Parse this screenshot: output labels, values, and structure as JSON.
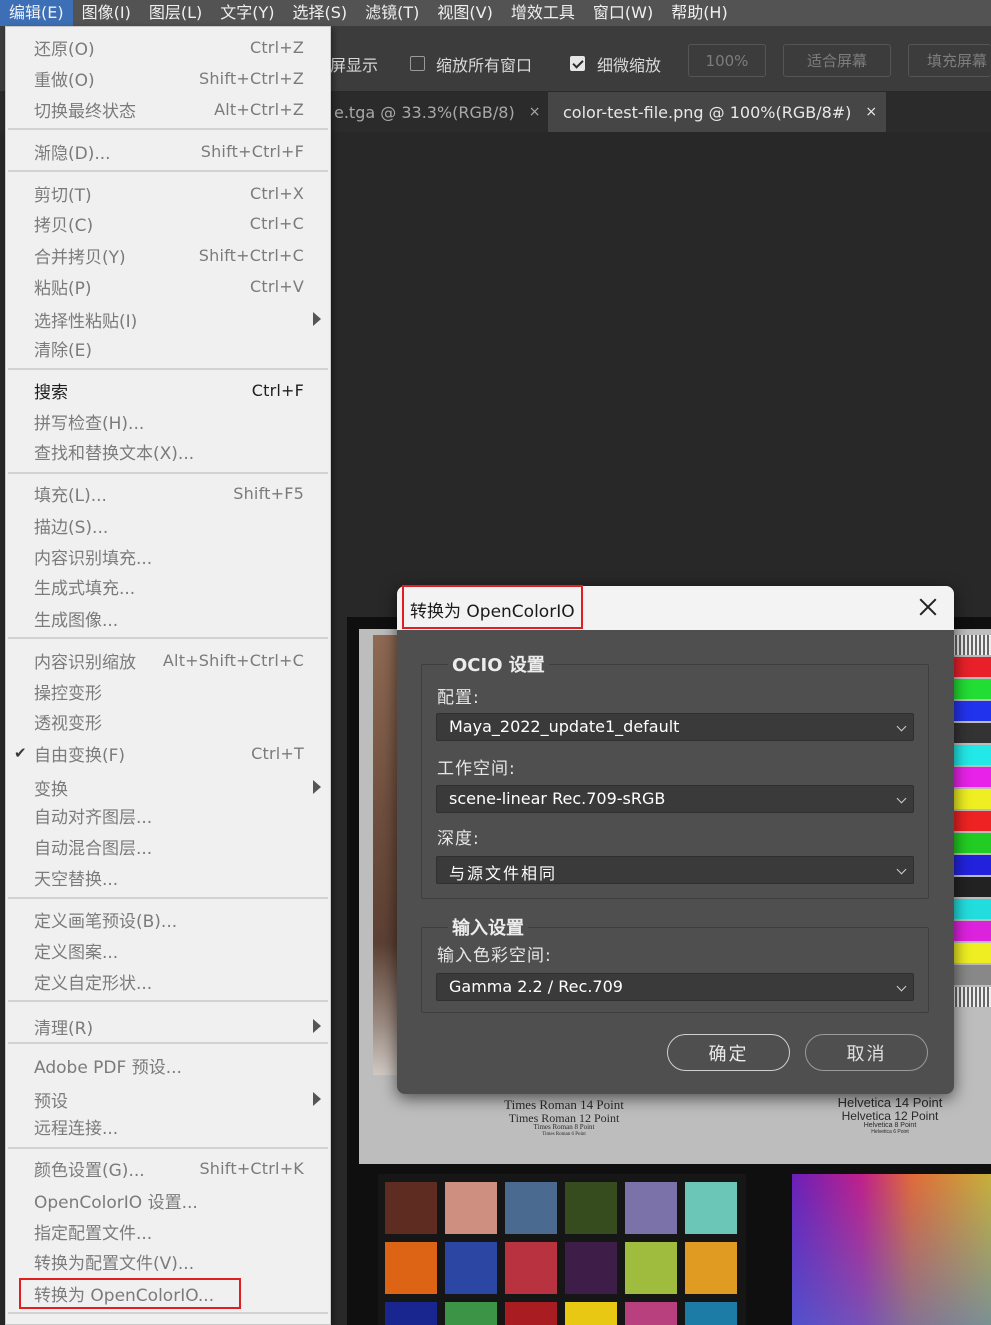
{
  "menubar": {
    "items": [
      "编辑(E)",
      "图像(I)",
      "图层(L)",
      "文字(Y)",
      "选择(S)",
      "滤镜(T)",
      "视图(V)",
      "增效工具",
      "窗口(W)",
      "帮助(H)"
    ]
  },
  "options": {
    "partial_text": "屏显示",
    "zoom_all_windows": "缩放所有窗口",
    "scrubby_zoom": "细微缩放",
    "zoom_value": "100%",
    "fit_screen": "适合屏幕",
    "fill_screen": "填充屏幕"
  },
  "tabs": [
    {
      "label": "e.tga @ 33.3%(RGB/8)",
      "close": "×"
    },
    {
      "label": "color-test-file.png @ 100%(RGB/8#)",
      "close": "×"
    }
  ],
  "doc": {
    "caption_times": [
      "Times Roman 14 Point",
      "Times Roman 12 Point",
      "Times Roman 8 Point",
      "Times Roman 6 Point"
    ],
    "caption_helv": [
      "Helvetica 14 Point",
      "Helvetica 12 Point",
      "Helvetica 8 Point",
      "Helvetica 6 Point"
    ]
  },
  "menu": {
    "items": [
      {
        "label": "还原(O)",
        "shortcut": "Ctrl+Z",
        "enabled": false
      },
      {
        "label": "重做(O)",
        "shortcut": "Shift+Ctrl+Z",
        "enabled": false
      },
      {
        "label": "切换最终状态",
        "shortcut": "Alt+Ctrl+Z",
        "enabled": false
      },
      {
        "label": "渐隐(D)...",
        "shortcut": "Shift+Ctrl+F",
        "enabled": false
      },
      {
        "label": "剪切(T)",
        "shortcut": "Ctrl+X",
        "enabled": false
      },
      {
        "label": "拷贝(C)",
        "shortcut": "Ctrl+C",
        "enabled": false
      },
      {
        "label": "合并拷贝(Y)",
        "shortcut": "Shift+Ctrl+C",
        "enabled": false
      },
      {
        "label": "粘贴(P)",
        "shortcut": "Ctrl+V",
        "enabled": false
      },
      {
        "label": "选择性粘贴(I)",
        "shortcut": "",
        "enabled": false,
        "submenu": true
      },
      {
        "label": "清除(E)",
        "shortcut": "",
        "enabled": false
      },
      {
        "label": "搜索",
        "shortcut": "Ctrl+F",
        "enabled": true
      },
      {
        "label": "拼写检查(H)...",
        "shortcut": "",
        "enabled": false
      },
      {
        "label": "查找和替换文本(X)...",
        "shortcut": "",
        "enabled": false
      },
      {
        "label": "填充(L)...",
        "shortcut": "Shift+F5",
        "enabled": false
      },
      {
        "label": "描边(S)...",
        "shortcut": "",
        "enabled": false
      },
      {
        "label": "内容识别填充...",
        "shortcut": "",
        "enabled": false
      },
      {
        "label": "生成式填充...",
        "shortcut": "",
        "enabled": false
      },
      {
        "label": "生成图像...",
        "shortcut": "",
        "enabled": false
      },
      {
        "label": "内容识别缩放",
        "shortcut": "Alt+Shift+Ctrl+C",
        "enabled": false
      },
      {
        "label": "操控变形",
        "shortcut": "",
        "enabled": false
      },
      {
        "label": "透视变形",
        "shortcut": "",
        "enabled": false
      },
      {
        "label": "自由变换(F)",
        "shortcut": "Ctrl+T",
        "enabled": false,
        "checked": true
      },
      {
        "label": "变换",
        "shortcut": "",
        "enabled": false,
        "submenu": true
      },
      {
        "label": "自动对齐图层...",
        "shortcut": "",
        "enabled": false
      },
      {
        "label": "自动混合图层...",
        "shortcut": "",
        "enabled": false
      },
      {
        "label": "天空替换...",
        "shortcut": "",
        "enabled": false
      },
      {
        "label": "定义画笔预设(B)...",
        "shortcut": "",
        "enabled": false
      },
      {
        "label": "定义图案...",
        "shortcut": "",
        "enabled": false
      },
      {
        "label": "定义自定形状...",
        "shortcut": "",
        "enabled": false
      },
      {
        "label": "清理(R)",
        "shortcut": "",
        "enabled": false,
        "submenu": true
      },
      {
        "label": "Adobe PDF 预设...",
        "shortcut": "",
        "enabled": false
      },
      {
        "label": "预设",
        "shortcut": "",
        "enabled": false,
        "submenu": true
      },
      {
        "label": "远程连接...",
        "shortcut": "",
        "enabled": false
      },
      {
        "label": "颜色设置(G)...",
        "shortcut": "Shift+Ctrl+K",
        "enabled": false
      },
      {
        "label": "OpenColorIO 设置...",
        "shortcut": "",
        "enabled": false
      },
      {
        "label": "指定配置文件...",
        "shortcut": "",
        "enabled": false
      },
      {
        "label": "转换为配置文件(V)...",
        "shortcut": "",
        "enabled": false
      },
      {
        "label": "转换为 OpenColorIO...",
        "shortcut": "",
        "enabled": false
      }
    ]
  },
  "dialog": {
    "title": "转换为 OpenColorIO",
    "ocio_group_title": "OCIO 设置",
    "config_label": "配置:",
    "config_value": "Maya_2022_update1_default",
    "workspace_label": "工作空间:",
    "workspace_value": "scene-linear Rec.709-sRGB",
    "depth_label": "深度:",
    "depth_value": "与源文件相同",
    "input_group_title": "输入设置",
    "input_space_label": "输入色彩空间:",
    "input_space_value": "Gamma 2.2 / Rec.709",
    "ok_label": "确定",
    "cancel_label": "取消"
  },
  "colors": {
    "menubar_bg": "#535353",
    "menubar_active": "#3d6fb6",
    "menu_bg": "#f0f0f0",
    "dialog_bg": "#4f4f4f",
    "highlight_red": "#e02020"
  }
}
